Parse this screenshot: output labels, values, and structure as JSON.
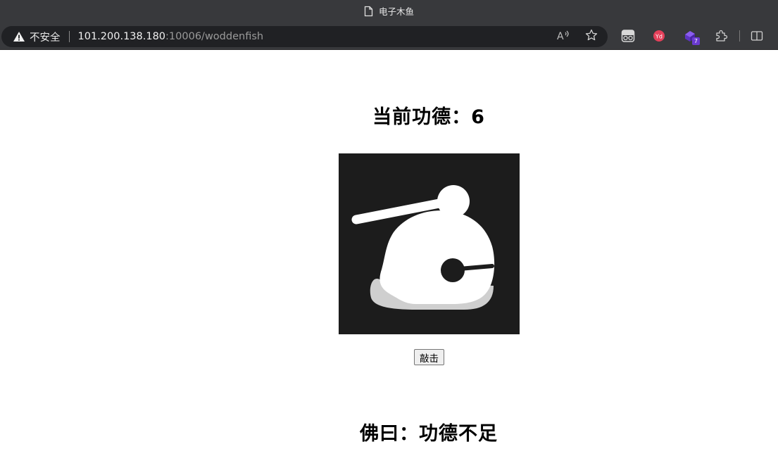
{
  "browser": {
    "tab_title": "电子木鱼",
    "security_label": "不安全",
    "url_host": "101.200.138.180",
    "url_path": ":10006/woddenfish",
    "extension_badge": "7"
  },
  "page": {
    "merit_label": "当前功德：",
    "merit_value": "6",
    "knock_button": "敲击",
    "buddha_message": "佛曰：功德不足"
  },
  "colors": {
    "chrome_bg": "#38393c",
    "address_bg": "#202124",
    "fish_bg": "#1c1c1c"
  }
}
